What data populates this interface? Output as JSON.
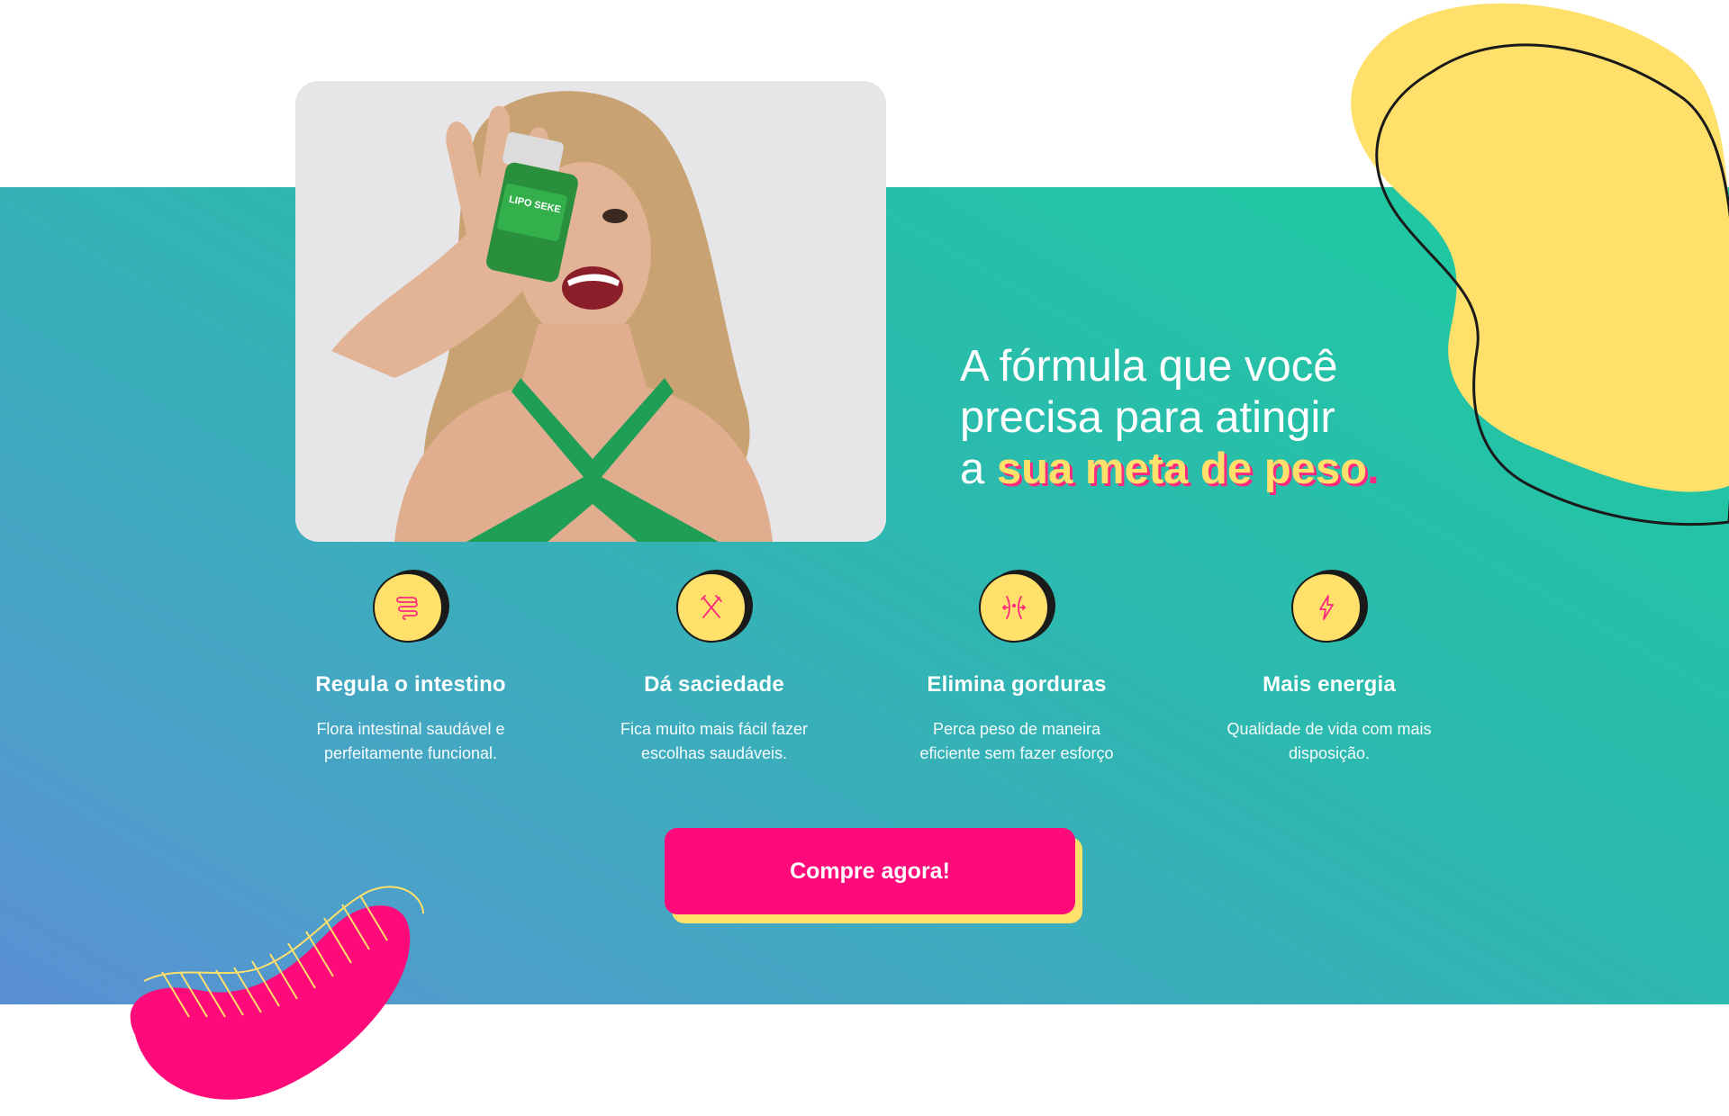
{
  "hero": {
    "headline_line1": "A fórmula que você",
    "headline_line2": "precisa para atingir",
    "headline_prefix": "a ",
    "headline_highlight": "sua meta de peso",
    "headline_suffix": ".",
    "image_alt": "Mulher segurando um frasco verde do suplemento em frente ao rosto",
    "bottle_label": "LIPO SEKE"
  },
  "features": [
    {
      "icon": "intestine-icon",
      "title": "Regula o intestino",
      "desc_line1": "Flora intestinal saudável e",
      "desc_line2": "perfeitamente funcional."
    },
    {
      "icon": "fork-knife-icon",
      "title": "Dá saciedade",
      "desc_line1": "Fica muito mais fácil fazer",
      "desc_line2": "escolhas saudáveis."
    },
    {
      "icon": "waist-icon",
      "title": "Elimina gorduras",
      "desc_line1": "Perca peso de maneira",
      "desc_line2": "eficiente sem fazer esforço"
    },
    {
      "icon": "lightning-icon",
      "title": "Mais energia",
      "desc_line1": "Qualidade de vida  com mais",
      "desc_line2": "disposição."
    }
  ],
  "cta": {
    "label": "Compre agora!"
  },
  "colors": {
    "accent_yellow": "#ffe06a",
    "accent_pink": "#ff0a7a",
    "band_top": "#1ccc9e",
    "band_bottom": "#5b8fd4"
  }
}
